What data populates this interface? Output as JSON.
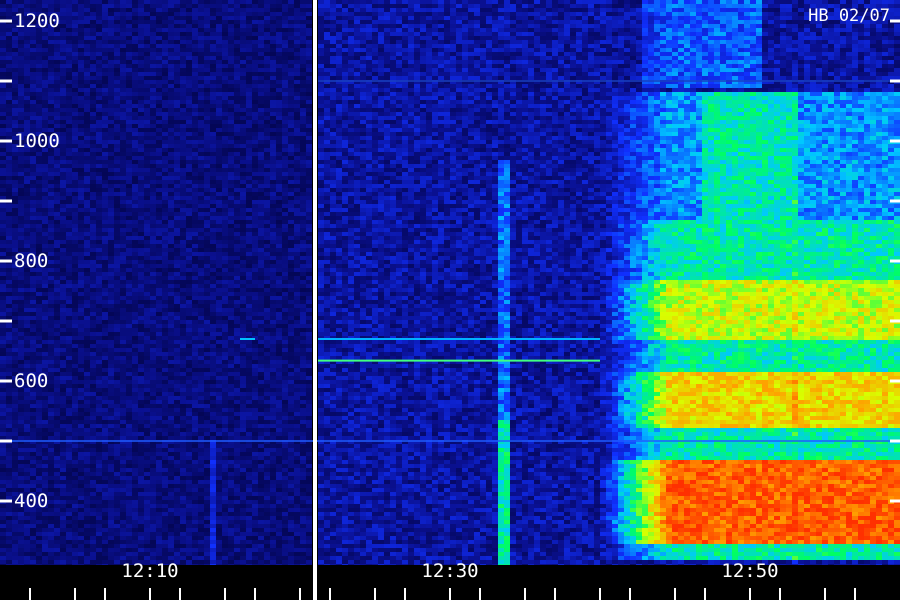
{
  "chart_data": {
    "type": "heatmap",
    "title": "",
    "xlabel": "",
    "ylabel": "",
    "annotation": "HB 02/07",
    "y_range": [
      310,
      1290
    ],
    "y_ticks": [
      400,
      600,
      800,
      1000,
      1200
    ],
    "y_ticklabels": [
      "400",
      "600",
      "800",
      "1000",
      "1200"
    ],
    "y_minor_ticks": [
      500,
      700,
      900,
      1100
    ],
    "x_range_minutes": [
      "12:01",
      "12:59"
    ],
    "x_ticklabels": [
      "12:10",
      "12:30",
      "12:50"
    ],
    "x_tick_times": [
      "12:10",
      "12:30",
      "12:50"
    ],
    "x_minor_tick_times": [
      "12:02",
      "12:05",
      "12:07",
      "12:12",
      "12:15",
      "12:17",
      "12:20",
      "12:22",
      "12:25",
      "12:27",
      "12:32",
      "12:35",
      "12:37",
      "12:40",
      "12:42",
      "12:45",
      "12:47",
      "12:52",
      "12:55",
      "12:57"
    ],
    "segment_break_time": "12:21",
    "colormap": [
      "#000030",
      "#0a1090",
      "#1030ff",
      "#00c8ff",
      "#00ff60",
      "#d8ff00",
      "#ffa000",
      "#ff3000"
    ],
    "grid": false,
    "regions": [
      {
        "name": "background",
        "intensity": 0.1
      },
      {
        "name": "event-onset-12:40",
        "intensity": 0.7
      },
      {
        "name": "peak-band-400",
        "intensity": 0.95
      }
    ]
  }
}
